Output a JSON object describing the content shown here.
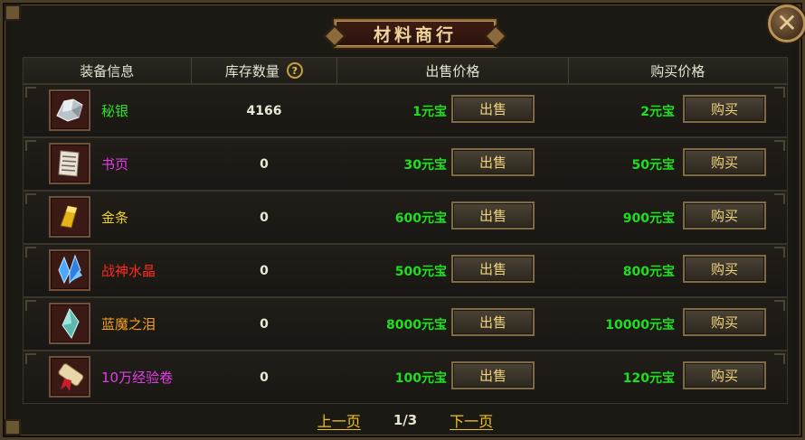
{
  "window": {
    "title": "材料商行"
  },
  "header": {
    "col_item": "装备信息",
    "col_stock": "库存数量",
    "col_sell": "出售价格",
    "col_buy": "购买价格",
    "help_glyph": "?"
  },
  "colors": {
    "item_green": "#2be02b",
    "item_magenta": "#e23de8",
    "item_yellow": "#f1d21a",
    "item_red": "#ff2a1f",
    "item_orange": "#f3a01b",
    "price_green": "#1fe01f"
  },
  "items": [
    {
      "name": "秘银",
      "name_color": "#2be02b",
      "icon": "silver-ore-icon",
      "stock": "4166",
      "sell_price": "1元宝",
      "sell_label": "出售",
      "buy_price": "2元宝",
      "buy_label": "购买"
    },
    {
      "name": "书页",
      "name_color": "#e23de8",
      "icon": "book-page-icon",
      "stock": "0",
      "sell_price": "30元宝",
      "sell_label": "出售",
      "buy_price": "50元宝",
      "buy_label": "购买"
    },
    {
      "name": "金条",
      "name_color": "#f1d21a",
      "icon": "gold-bar-icon",
      "stock": "0",
      "sell_price": "600元宝",
      "sell_label": "出售",
      "buy_price": "900元宝",
      "buy_label": "购买"
    },
    {
      "name": "战神水晶",
      "name_color": "#ff2a1f",
      "icon": "blue-crystal-icon",
      "stock": "0",
      "sell_price": "500元宝",
      "sell_label": "出售",
      "buy_price": "800元宝",
      "buy_label": "购买"
    },
    {
      "name": "蓝魔之泪",
      "name_color": "#f3a01b",
      "icon": "teal-gem-icon",
      "stock": "0",
      "sell_price": "8000元宝",
      "sell_label": "出售",
      "buy_price": "10000元宝",
      "buy_label": "购买"
    },
    {
      "name": "10万经验卷",
      "name_color": "#e23de8",
      "icon": "scroll-icon",
      "stock": "0",
      "sell_price": "100元宝",
      "sell_label": "出售",
      "buy_price": "120元宝",
      "buy_label": "购买"
    }
  ],
  "pager": {
    "prev": "上一页",
    "info": "1/3",
    "next": "下一页"
  }
}
